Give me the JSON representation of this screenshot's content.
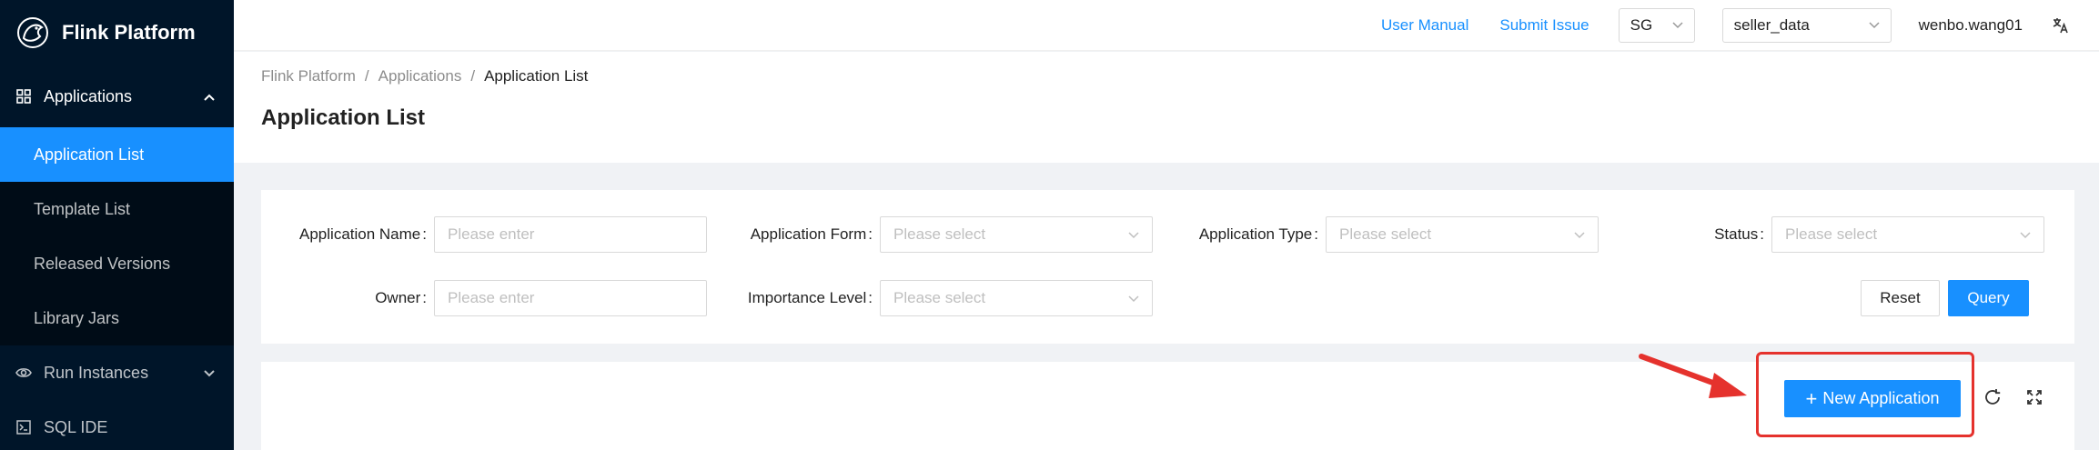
{
  "app": {
    "title": "Flink Platform"
  },
  "sidebar": {
    "groups": [
      {
        "label": "Applications",
        "icon": "grid-icon",
        "expanded": true,
        "items": [
          {
            "label": "Application List",
            "active": true
          },
          {
            "label": "Template List"
          },
          {
            "label": "Released Versions"
          },
          {
            "label": "Library Jars"
          }
        ]
      },
      {
        "label": "Run Instances",
        "icon": "eye-icon",
        "expanded": false
      },
      {
        "label": "SQL IDE",
        "icon": "terminal-icon"
      }
    ]
  },
  "header": {
    "user_manual": "User Manual",
    "submit_issue": "Submit Issue",
    "region": "SG",
    "project": "seller_data",
    "username": "wenbo.wang01",
    "language_icon": "translate-icon"
  },
  "breadcrumb": [
    "Flink Platform",
    "Applications",
    "Application List"
  ],
  "page_title": "Application List",
  "filters": {
    "app_name": {
      "label": "Application Name",
      "placeholder": "Please enter"
    },
    "app_form": {
      "label": "Application Form",
      "placeholder": "Please select"
    },
    "app_type": {
      "label": "Application Type",
      "placeholder": "Please select"
    },
    "status": {
      "label": "Status",
      "placeholder": "Please select"
    },
    "owner": {
      "label": "Owner",
      "placeholder": "Please enter"
    },
    "importance": {
      "label": "Importance Level",
      "placeholder": "Please select"
    },
    "colon": ":",
    "reset": "Reset",
    "query": "Query"
  },
  "toolbar": {
    "new_application": "New Application",
    "refresh_icon": "refresh-icon",
    "fullscreen_icon": "fullscreen-icon"
  },
  "colors": {
    "primary": "#1890ff",
    "sidebar_bg": "#001529",
    "highlight": "#e5322d"
  }
}
